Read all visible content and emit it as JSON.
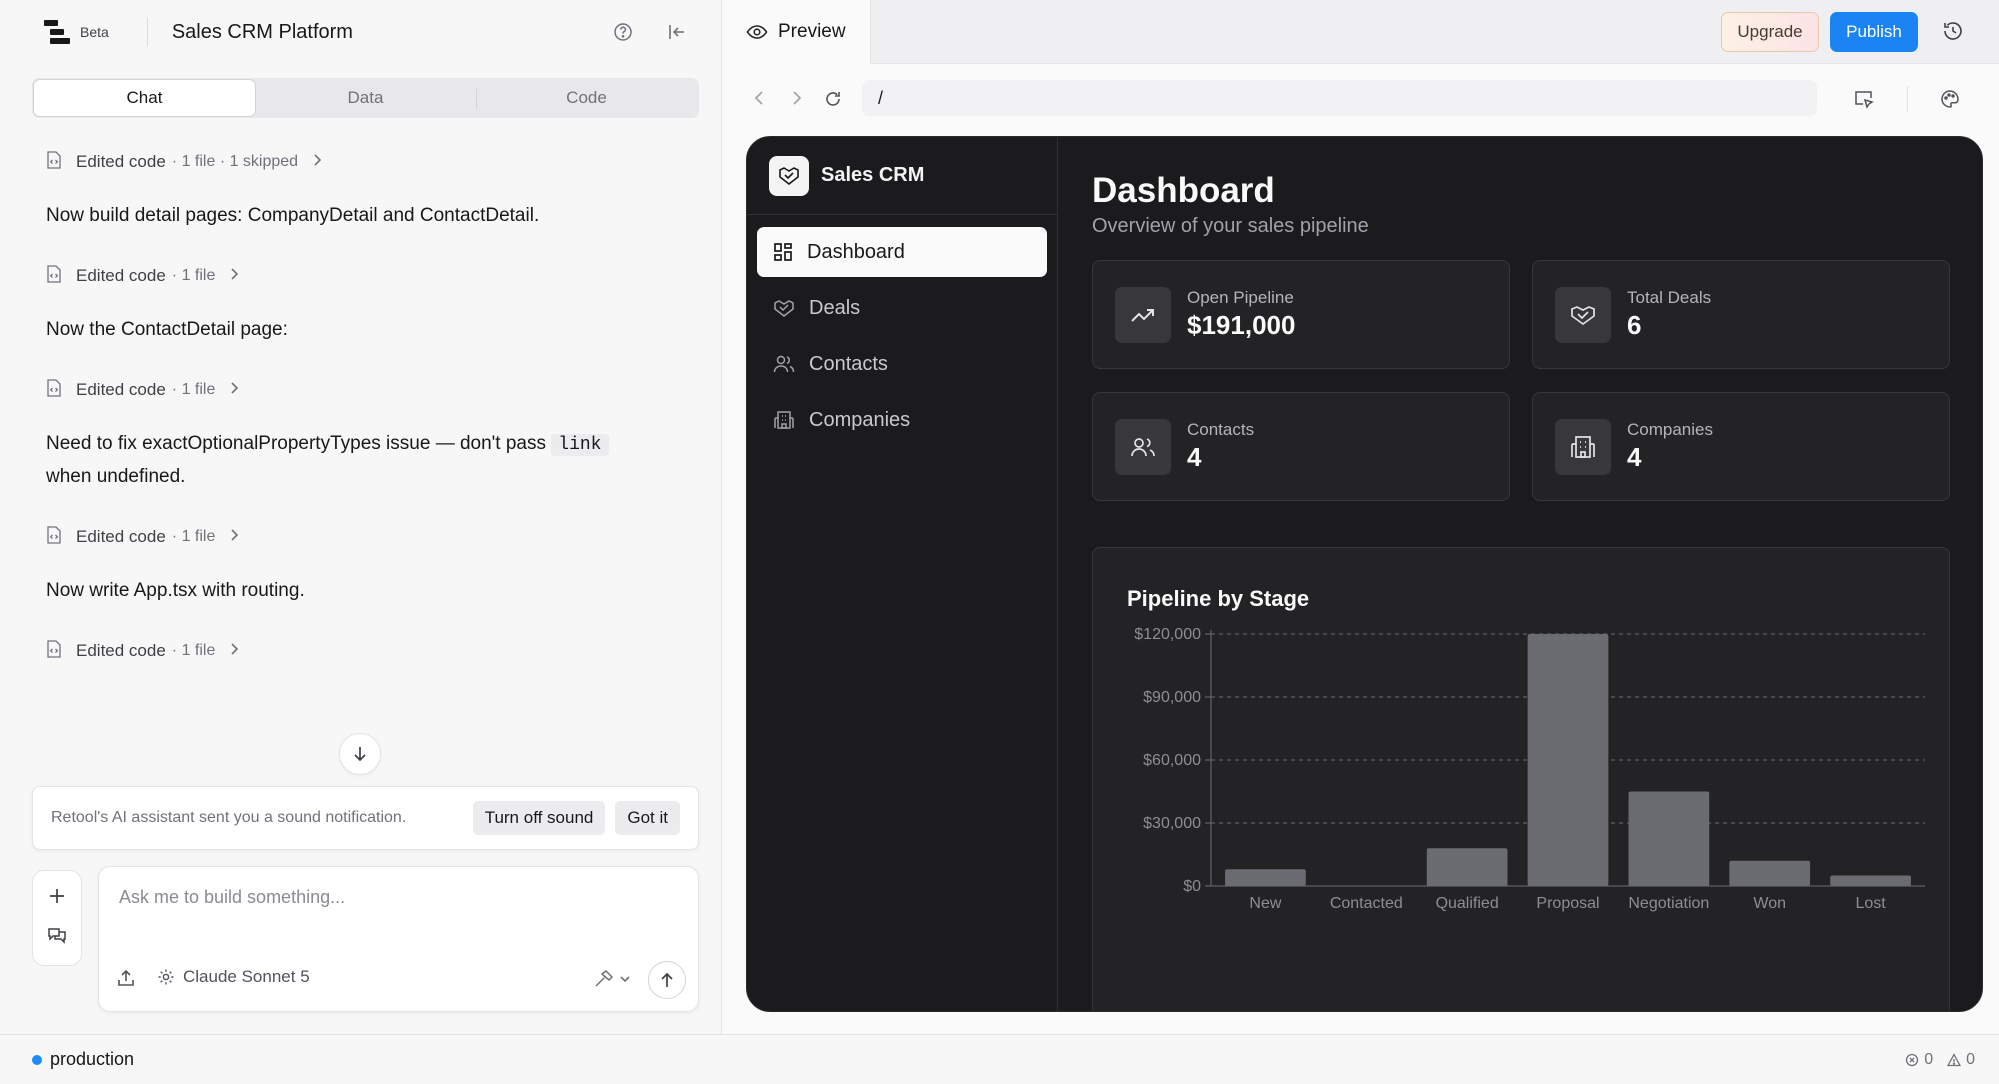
{
  "left": {
    "beta": "Beta",
    "app_title": "Sales CRM Platform",
    "tabs": [
      "Chat",
      "Data",
      "Code"
    ],
    "active_tab": "Chat",
    "messages": [
      {
        "type": "edit",
        "label": "Edited code",
        "meta": "· 1 file · 1 skipped"
      },
      {
        "type": "text",
        "text": "Now build detail pages: CompanyDetail and ContactDetail."
      },
      {
        "type": "edit",
        "label": "Edited code",
        "meta": "· 1 file"
      },
      {
        "type": "text",
        "text": "Now the ContactDetail page:"
      },
      {
        "type": "edit",
        "label": "Edited code",
        "meta": "· 1 file"
      },
      {
        "type": "text_code",
        "before": "Need to fix exactOptionalPropertyTypes issue — don't pass ",
        "code": "link",
        "after": "when undefined."
      },
      {
        "type": "edit",
        "label": "Edited code",
        "meta": "· 1 file"
      },
      {
        "type": "text",
        "text": "Now write App.tsx with routing."
      },
      {
        "type": "edit",
        "label": "Edited code",
        "meta": "· 1 file"
      }
    ],
    "notice": {
      "text": "Retool's AI assistant sent you a sound notification.",
      "turn_off": "Turn off sound",
      "got_it": "Got it"
    },
    "composer": {
      "placeholder": "Ask me to build something...",
      "model": "Claude Sonnet 5"
    }
  },
  "status": {
    "environment": "production",
    "errors": "0",
    "warnings": "0",
    "env_color": "#1d8cf8"
  },
  "right": {
    "preview_label": "Preview",
    "upgrade": "Upgrade",
    "publish": "Publish",
    "publish_color": "#1a85f2",
    "url": "/"
  },
  "app": {
    "brand": "Sales CRM",
    "nav": [
      {
        "label": "Dashboard",
        "icon": "grid-icon",
        "active": true
      },
      {
        "label": "Deals",
        "icon": "handshake-icon",
        "active": false
      },
      {
        "label": "Contacts",
        "icon": "users-icon",
        "active": false
      },
      {
        "label": "Companies",
        "icon": "building-icon",
        "active": false
      }
    ],
    "title": "Dashboard",
    "subtitle": "Overview of your sales pipeline",
    "cards": [
      {
        "label": "Open Pipeline",
        "value": "$191,000",
        "icon": "trending-up-icon"
      },
      {
        "label": "Total Deals",
        "value": "6",
        "icon": "handshake-icon"
      },
      {
        "label": "Contacts",
        "value": "4",
        "icon": "users-icon"
      },
      {
        "label": "Companies",
        "value": "4",
        "icon": "building-icon"
      }
    ]
  },
  "chart_data": {
    "type": "bar",
    "title": "Pipeline by Stage",
    "categories": [
      "New",
      "Contacted",
      "Qualified",
      "Proposal",
      "Negotiation",
      "Won",
      "Lost"
    ],
    "values": [
      8000,
      0,
      18000,
      120000,
      45000,
      12000,
      5000
    ],
    "y_ticks": [
      "$0",
      "$30,000",
      "$60,000",
      "$90,000",
      "$120,000"
    ],
    "ylim": [
      0,
      120000
    ],
    "grid": true,
    "bar_color": "#6b6b72"
  }
}
